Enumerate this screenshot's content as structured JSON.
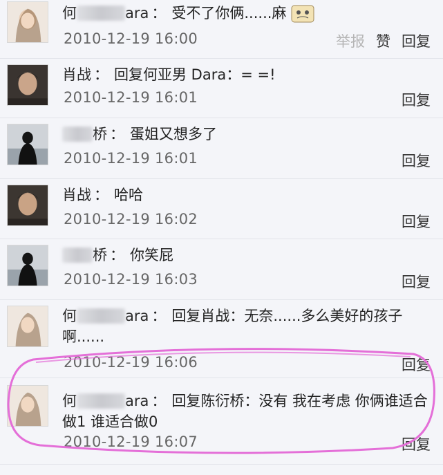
{
  "comments": [
    {
      "name_visible_prefix": "何",
      "name_visible_suffix": "ara",
      "text": "受不了你俩......麻",
      "timestamp": "2010-12-19 16:00",
      "report_label": "举报",
      "like_label": "赞",
      "reply_label": "回复"
    },
    {
      "name": "肖战",
      "text": "回复何亚男 Dara：= =!",
      "timestamp": "2010-12-19 16:01",
      "reply_label": "回复"
    },
    {
      "name_visible_suffix": "桥",
      "text": "蛋姐又想多了",
      "timestamp": "2010-12-19 16:01",
      "reply_label": "回复"
    },
    {
      "name": "肖战",
      "text": "哈哈",
      "timestamp": "2010-12-19 16:02",
      "reply_label": "回复"
    },
    {
      "name_visible_suffix": "桥",
      "text": "你笑屁",
      "timestamp": "2010-12-19 16:03",
      "reply_label": "回复"
    },
    {
      "name_visible_prefix": "何",
      "name_visible_suffix": "ara",
      "text": "回复肖战：无奈......多么美好的孩子啊......",
      "timestamp": "2010-12-19 16:06",
      "reply_label": "回复"
    },
    {
      "name_visible_prefix": "何",
      "name_visible_suffix": "ara",
      "text": "回复陈衍桥：没有 我在考虑 你俩谁适合做1 谁适合做0",
      "timestamp": "2010-12-19 16:07",
      "reply_label": "回复"
    }
  ],
  "colon": "：",
  "colors": {
    "background": "#f4f5f9",
    "highlight": "#e46fd8",
    "timestamp": "#666666"
  }
}
